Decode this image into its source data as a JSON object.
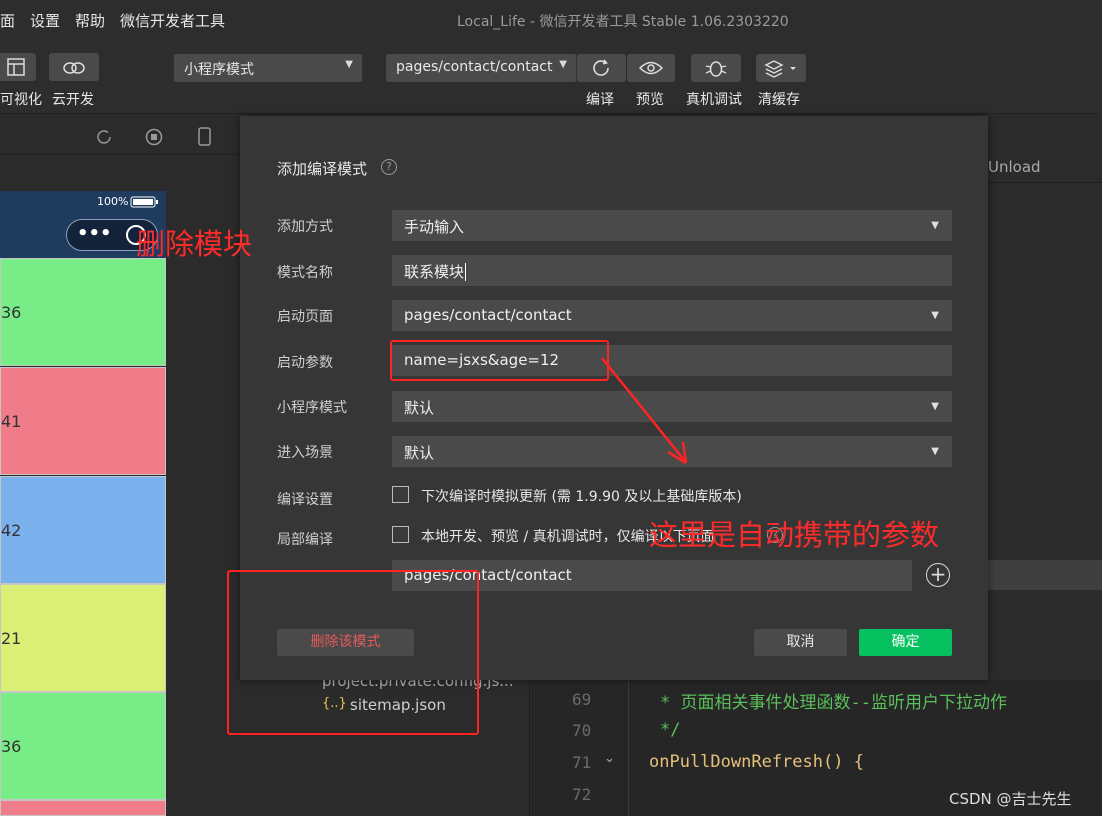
{
  "menubar": {
    "items": [
      "面",
      "设置",
      "帮助",
      "微信开发者工具"
    ],
    "window_title": "Local_Life - 微信开发者工具 Stable 1.06.2303220"
  },
  "toolbar": {
    "left_labels": [
      "可视化",
      "云开发"
    ],
    "mode_select": "小程序模式",
    "page_select": "pages/contact/contact",
    "actions": [
      "编译",
      "预览",
      "真机调试",
      "清缓存"
    ]
  },
  "simulator": {
    "battery": "100%",
    "cards": [
      "36",
      "41",
      "42",
      "21",
      "36"
    ]
  },
  "dialog": {
    "title": "添加编译模式",
    "help": "?",
    "fields": [
      {
        "label": "添加方式",
        "value": "手动输入"
      },
      {
        "label": "模式名称",
        "value": "联系模块"
      },
      {
        "label": "启动页面",
        "value": "pages/contact/contact"
      },
      {
        "label": "启动参数",
        "value": "name=jsxs&age=12"
      },
      {
        "label": "小程序模式",
        "value": "默认"
      },
      {
        "label": "进入场景",
        "value": "默认"
      }
    ],
    "compile_label": "编译设置",
    "compile_checkbox": "下次编译时模拟更新 (需 1.9.90 及以上基础库版本)",
    "partial_label": "局部编译",
    "partial_checkbox": "本地开发、预览 / 真机调试时，仅编译以下页面",
    "partial_page": "pages/contact/contact",
    "delete_button": "删除该模式",
    "cancel_button": "取消",
    "confirm_button": "确定"
  },
  "background": {
    "tab": "Unload",
    "files": [
      "project.private.config.js...",
      "sitemap.json"
    ],
    "file_icon": "{..}",
    "lines": [
      "69",
      "70",
      "71",
      "72"
    ],
    "code": [
      "* 页面相关事件处理函数--监听用户下拉动作",
      "*/",
      "onPullDownRefresh() {"
    ]
  },
  "annotations": {
    "delete_module": "删除模块",
    "auto_params": "这里是自动携带的参数"
  },
  "watermark": "CSDN @吉士先生",
  "colors": {
    "card_green": "#77ec87",
    "card_red": "#f07b89",
    "card_blue": "#7bb1ed",
    "card_yellow": "#dbee76",
    "confirm_green": "#07c160",
    "annotation_red": "#ff2a2a"
  }
}
